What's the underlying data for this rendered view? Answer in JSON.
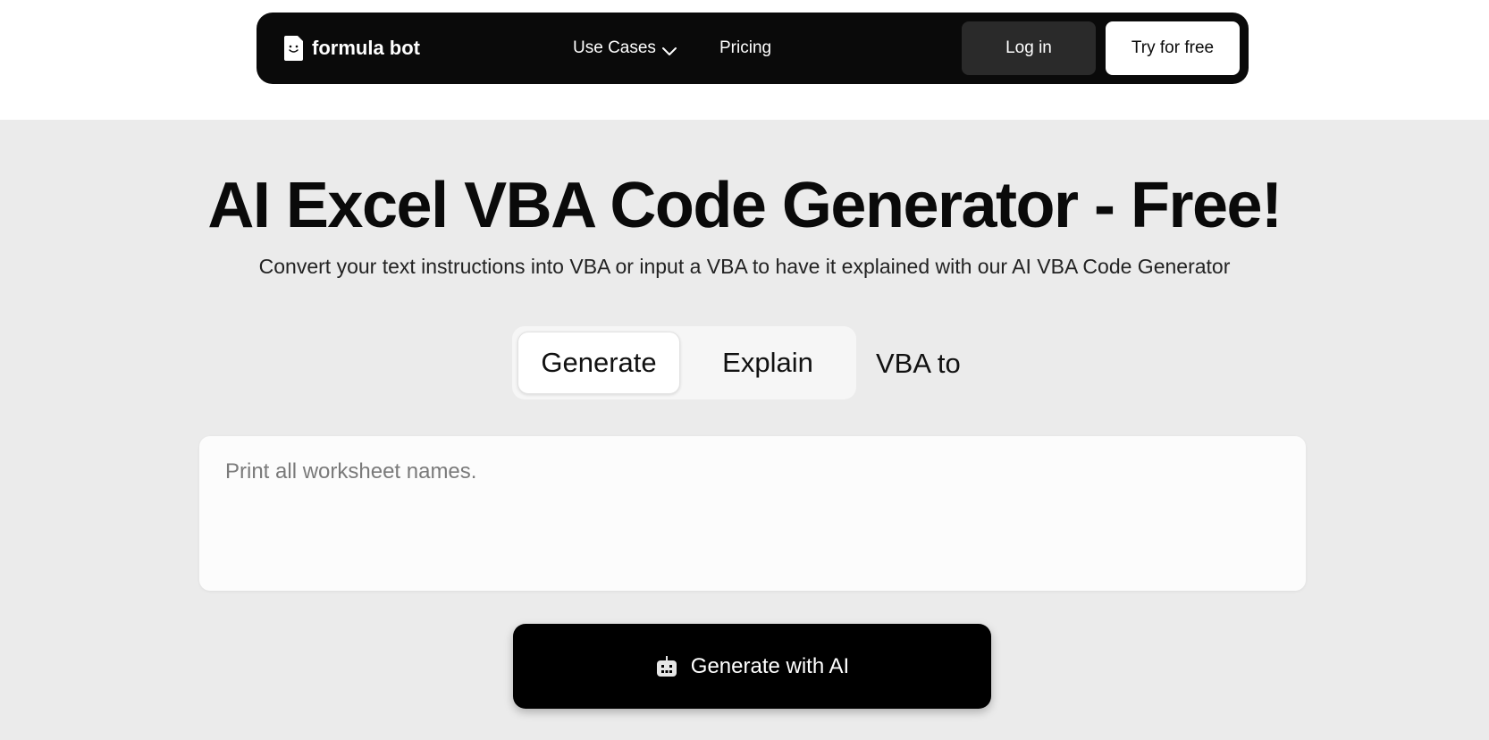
{
  "brand": {
    "name": "formula bot",
    "icon": "smiling-document-logo"
  },
  "nav": {
    "use_cases": "Use Cases",
    "pricing": "Pricing",
    "login": "Log in",
    "try_free": "Try for free"
  },
  "hero": {
    "title": "AI Excel VBA Code Generator - Free!",
    "subtitle": "Convert your text instructions into VBA or input a VBA to have it explained with our AI VBA Code Generator"
  },
  "tabs": [
    {
      "label": "Generate",
      "selected": true
    },
    {
      "label": "Explain",
      "selected": false
    },
    {
      "label": "VBA to",
      "selected": false
    }
  ],
  "prompt": {
    "placeholder": "Print all worksheet names.",
    "value": ""
  },
  "action": {
    "label": "Generate with AI",
    "icon": "robot-icon"
  },
  "colors": {
    "navbar": "#0a0a0a",
    "page_bg": "#ebebeb",
    "primary_button": "#000000",
    "login_button": "#2a2a2a"
  }
}
